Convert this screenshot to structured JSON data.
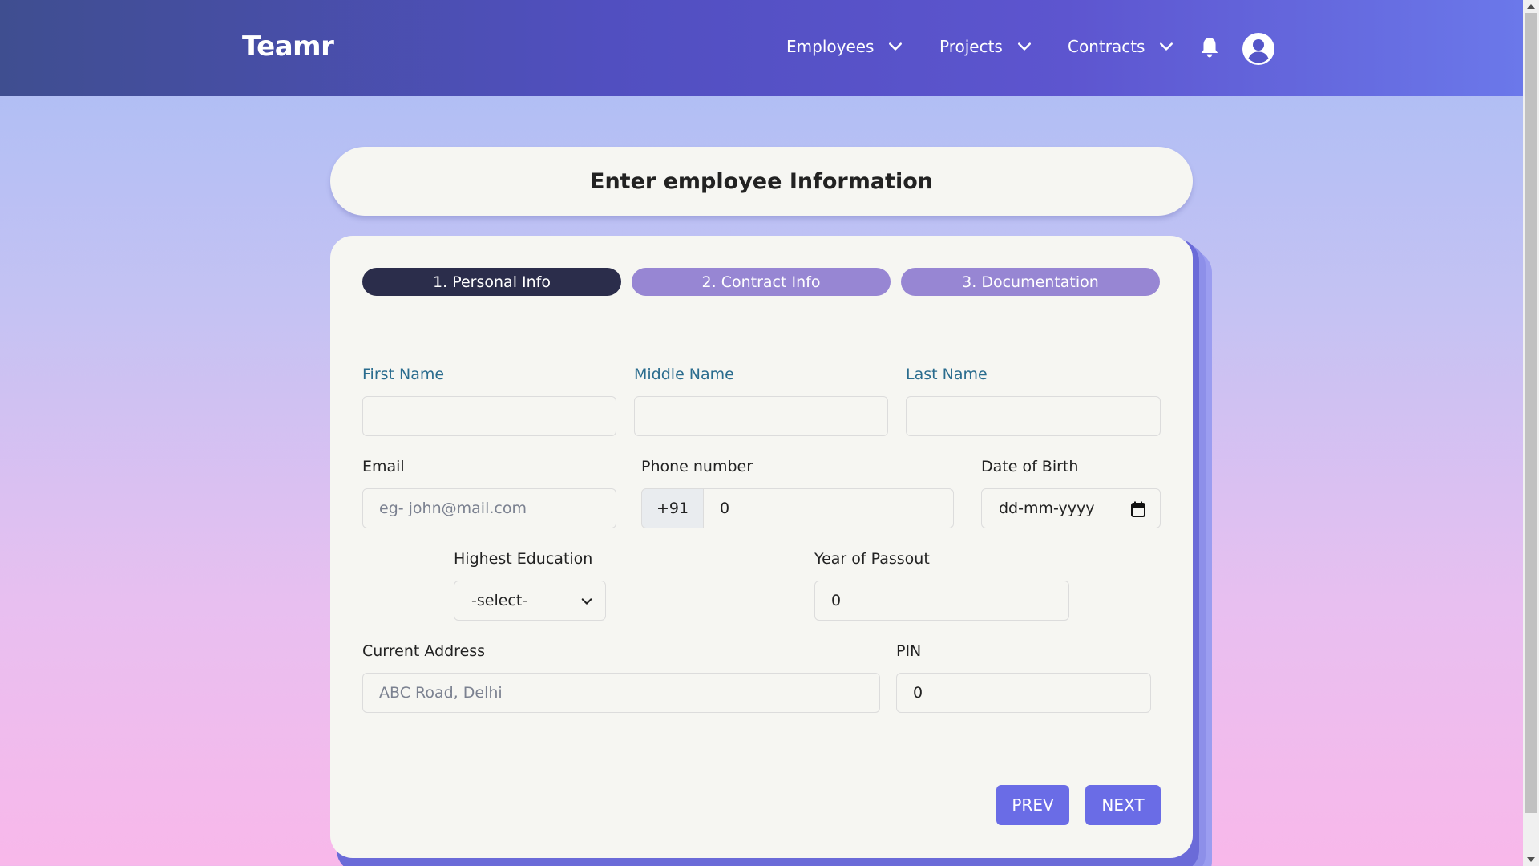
{
  "navbar": {
    "brand": "Teamr",
    "items": [
      {
        "label": "Employees"
      },
      {
        "label": "Projects"
      },
      {
        "label": "Contracts"
      }
    ]
  },
  "header": {
    "title": "Enter employee Information"
  },
  "steps": [
    {
      "label": "1. Personal Info",
      "active": true
    },
    {
      "label": "2. Contract Info",
      "active": false
    },
    {
      "label": "3. Documentation",
      "active": false
    }
  ],
  "form": {
    "first_name": {
      "label": "First Name",
      "value": ""
    },
    "middle_name": {
      "label": "Middle Name",
      "value": ""
    },
    "last_name": {
      "label": "Last Name",
      "value": ""
    },
    "email": {
      "label": "Email",
      "placeholder": "eg- john@mail.com"
    },
    "phone": {
      "label": "Phone number",
      "prefix": "+91",
      "value": "0"
    },
    "dob": {
      "label": "Date of Birth",
      "placeholder": "dd-mm-yyyy"
    },
    "education": {
      "label": "Highest Education",
      "selected": "-select-"
    },
    "passout": {
      "label": "Year of Passout",
      "value": "0"
    },
    "address": {
      "label": "Current Address",
      "placeholder": "ABC Road, Delhi"
    },
    "pin": {
      "label": "PIN",
      "value": "0"
    }
  },
  "buttons": {
    "prev": "PREV",
    "next": "NEXT"
  },
  "colors": {
    "accent": "#6a6ce6",
    "step_active": "#2b2d4b",
    "step_inactive": "#9786d3",
    "label_blue": "#2a6c8e"
  }
}
